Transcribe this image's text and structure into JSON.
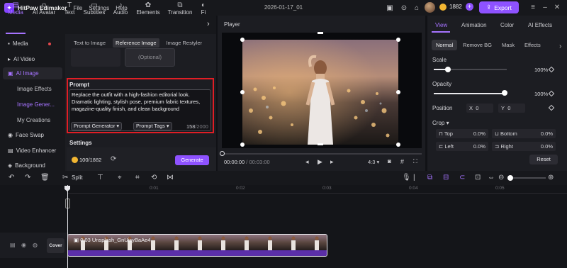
{
  "app": {
    "name": "HitPaw Edimakor",
    "menus": [
      "File",
      "Settings",
      "Help"
    ],
    "document_title": "2026-01-17_01",
    "credits": "1882",
    "export_label": "Export"
  },
  "toolbar": {
    "tabs": [
      {
        "label": "Media",
        "icon": "media-icon"
      },
      {
        "label": "AI Avatar",
        "icon": "avatar-icon"
      },
      {
        "label": "Text",
        "icon": "text-icon"
      },
      {
        "label": "Subtitles",
        "icon": "subtitles-icon"
      },
      {
        "label": "Audio",
        "icon": "audio-icon"
      },
      {
        "label": "Elements",
        "icon": "elements-icon"
      },
      {
        "label": "Transition",
        "icon": "transition-icon"
      },
      {
        "label": "Fi",
        "icon": "filter-icon"
      }
    ],
    "active": "Media"
  },
  "sidebar": {
    "items": [
      {
        "label": "Media"
      },
      {
        "label": "AI Video"
      },
      {
        "label": "AI Image"
      },
      {
        "label": "Face Swap"
      },
      {
        "label": "Video Enhancer"
      },
      {
        "label": "Background"
      }
    ],
    "ai_image_sub": [
      "Image Effects",
      "Image Gener...",
      "My Creations"
    ]
  },
  "panel": {
    "tabs": [
      "Text to Image",
      "Reference Image",
      "Image Restyler"
    ],
    "active_tab": "Reference Image",
    "optional_label": "(Optional)",
    "prompt_label": "Prompt",
    "prompt_text": "Replace the outfit with a high-fashion editorial look. Dramatic lighting, stylish pose, premium fabric textures, magazine-quality finish, and clean background",
    "prompt_generator_label": "Prompt Generator",
    "prompt_tags_label": "Prompt Tags",
    "char_count": "158",
    "char_max": "/2000",
    "settings_label": "Settings",
    "cost_used": "100",
    "cost_total": "/1882",
    "generate_label": "Generate"
  },
  "player": {
    "title": "Player",
    "current_time": "00:00:00",
    "total_time": "/ 00:03:00",
    "aspect_ratio": "4:3"
  },
  "properties": {
    "tabs": [
      "View",
      "Animation",
      "Color",
      "AI Effects"
    ],
    "active_tab": "View",
    "subtabs": [
      "Normal",
      "Remove BG",
      "Mask",
      "Effects"
    ],
    "active_subtab": "Normal",
    "scale_label": "Scale",
    "scale_value": "100%",
    "scale_level": 1.0,
    "opacity_label": "Opacity",
    "opacity_value": "100%",
    "opacity_level": 1.0,
    "position_label": "Position",
    "pos_x_label": "X",
    "pos_x": "0",
    "pos_y_label": "Y",
    "pos_y": "0",
    "crop_label": "Crop",
    "crop": [
      {
        "label": "Top",
        "value": "0.0%"
      },
      {
        "label": "Bottom",
        "value": "0.0%"
      },
      {
        "label": "Left",
        "value": "0.0%"
      },
      {
        "label": "Right",
        "value": "0.0%"
      }
    ],
    "reset_label": "Reset"
  },
  "timeline": {
    "split_label": "Split",
    "ticks": [
      "0:01",
      "0:02",
      "0:03",
      "0:04",
      "0:05"
    ],
    "cover_label": "Cover",
    "clip_label": "0:03 Unsplash_GnUisyBaAe4"
  },
  "colors": {
    "accent": "#8e52ff",
    "highlight": "#e01e25",
    "background": "#111216"
  }
}
